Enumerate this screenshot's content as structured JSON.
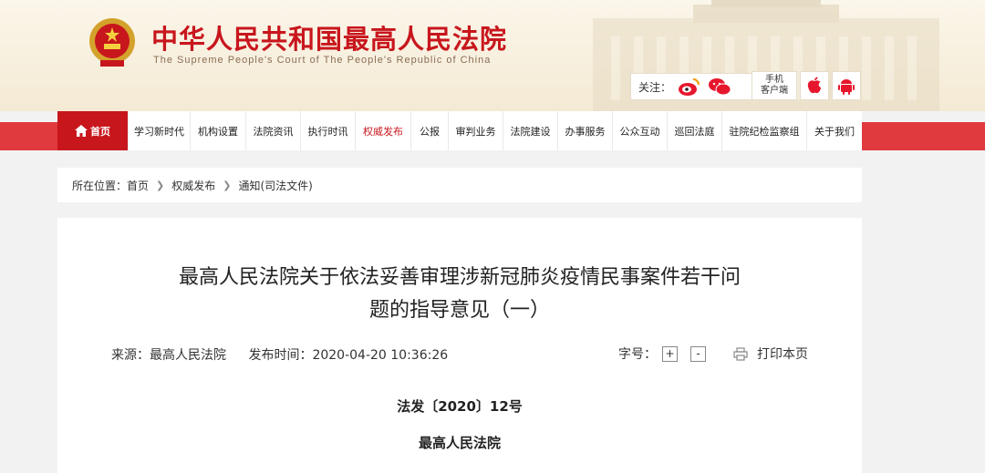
{
  "site": {
    "title": "中华人民共和国最高人民法院",
    "subtitle": "The Supreme People's Court of The People's Republic of China",
    "follow_label": "关注：",
    "mobile_label_1": "手机",
    "mobile_label_2": "客户端",
    "accent_color": "#c8161d"
  },
  "nav": {
    "items": [
      {
        "label": "首页"
      },
      {
        "label": "学习新时代"
      },
      {
        "label": "机构设置"
      },
      {
        "label": "法院资讯"
      },
      {
        "label": "执行时讯"
      },
      {
        "label": "权威发布"
      },
      {
        "label": "公报"
      },
      {
        "label": "审判业务"
      },
      {
        "label": "法院建设"
      },
      {
        "label": "办事服务"
      },
      {
        "label": "公众互动"
      },
      {
        "label": "巡回法庭"
      },
      {
        "label": "驻院纪检监察组"
      },
      {
        "label": "关于我们"
      }
    ]
  },
  "breadcrumb": {
    "prefix": "所在位置：",
    "items": [
      "首页",
      "权威发布",
      "通知(司法文件)"
    ]
  },
  "article": {
    "title_line1": "最高人民法院关于依法妥善审理涉新冠肺炎疫情民事案件若干问",
    "title_line2": "题的指导意见（一）",
    "source": "来源：最高人民法院",
    "published": "发布时间：2020-04-20 10:36:26",
    "font_size_label": "字号：",
    "font_plus": "+",
    "font_minus": "-",
    "print_label": "打印本页",
    "doc_number": "法发〔2020〕12号",
    "issuer": "最高人民法院"
  }
}
